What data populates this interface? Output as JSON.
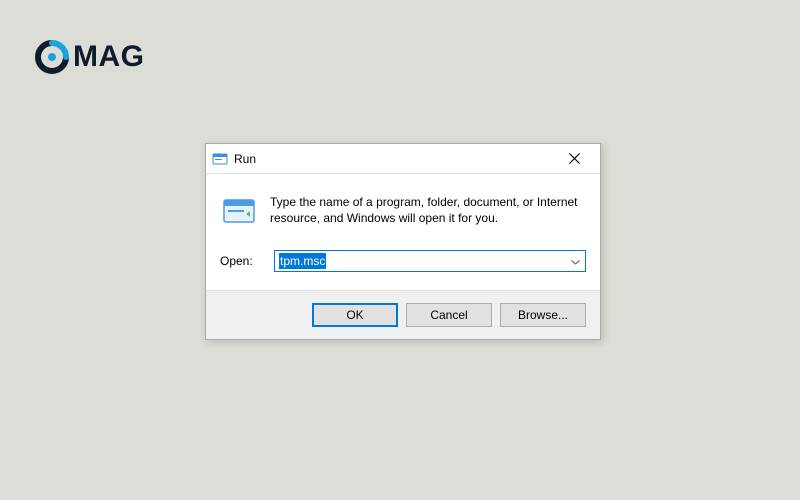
{
  "logo": {
    "text": "MAG"
  },
  "dialog": {
    "title": "Run",
    "description": "Type the name of a program, folder, document, or Internet resource, and Windows will open it for you.",
    "open_label": "Open:",
    "input_value": "tpm.msc",
    "buttons": {
      "ok": "OK",
      "cancel": "Cancel",
      "browse": "Browse..."
    }
  }
}
